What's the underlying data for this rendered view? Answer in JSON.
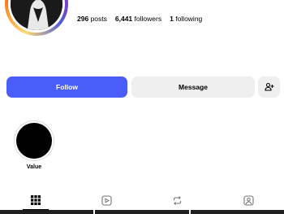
{
  "profile": {
    "stats": {
      "posts_count": "296",
      "posts_label": "posts",
      "followers_count": "6,441",
      "followers_label": "followers",
      "following_count": "1",
      "following_label": "following"
    }
  },
  "actions": {
    "follow_label": "Follow",
    "message_label": "Message",
    "add_user_icon": "person-plus-icon"
  },
  "highlights": [
    {
      "label": "Value"
    }
  ],
  "tabs": [
    {
      "icon": "grid-icon",
      "active": true
    },
    {
      "icon": "reels-icon",
      "active": false
    },
    {
      "icon": "reposts-icon",
      "active": false
    },
    {
      "icon": "tagged-icon",
      "active": false
    }
  ],
  "colors": {
    "follow_button": "#4a5df9",
    "secondary_button": "#efefef"
  }
}
